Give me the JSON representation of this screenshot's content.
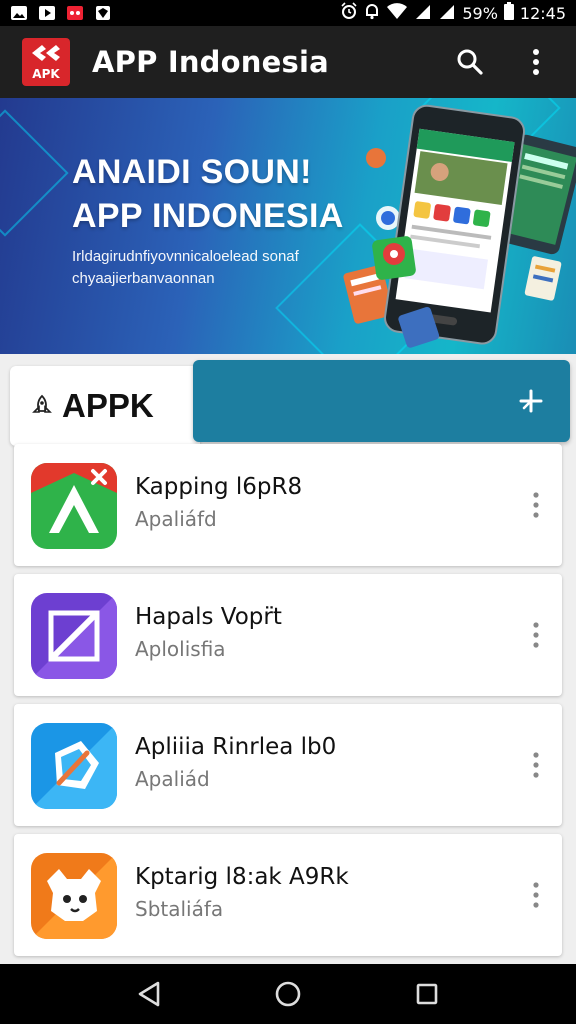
{
  "status_bar": {
    "battery": "59%",
    "time": "12:45",
    "left_icons": [
      "gallery-icon",
      "video-icon",
      "game-icon",
      "shield-icon"
    ],
    "right_icons": [
      "alarm-icon",
      "notification-icon",
      "wifi-icon",
      "signal-icon",
      "signal-icon",
      "battery-icon"
    ]
  },
  "app_bar": {
    "logo_text": "APK",
    "title": "APP Indonesia",
    "actions": [
      "search-icon",
      "more-vert-icon"
    ]
  },
  "banner": {
    "headline_line1": "ANAIDI SOUN!",
    "headline_line2": "APP INDONESIA",
    "subtext": "Irldagirudnfiyovnnicaloelead sonaf chyaajierbanvaonnan"
  },
  "section": {
    "label": "APPK",
    "icon": "rocket-icon",
    "action_icon": "add-icon"
  },
  "apps": [
    {
      "name": "Kapping l6pR8",
      "category": "Apaliáfd",
      "icon": "app-icon-green-red",
      "colors": [
        "#e2392c",
        "#2fb34a"
      ]
    },
    {
      "name": "Hapals Vopr̈t",
      "category": "Aplolisfia",
      "icon": "app-icon-purple",
      "colors": [
        "#6d3fd1",
        "#8a57e6"
      ]
    },
    {
      "name": "Apliiia Rinrlea lb0",
      "category": "Apaliád",
      "icon": "app-icon-blue",
      "colors": [
        "#1b96e6",
        "#3cb6f5"
      ]
    },
    {
      "name": "Kptarig l8:ak A9Rk",
      "category": "Sbtaliáfa",
      "icon": "app-icon-orange",
      "colors": [
        "#f07a1a",
        "#ff9a2e"
      ]
    }
  ],
  "nav": {
    "buttons": [
      "back-icon",
      "home-icon",
      "recents-icon"
    ]
  },
  "colors": {
    "app_bar": "#1f1f1f",
    "accent": "#1d7ea0",
    "logo": "#d8262b"
  }
}
